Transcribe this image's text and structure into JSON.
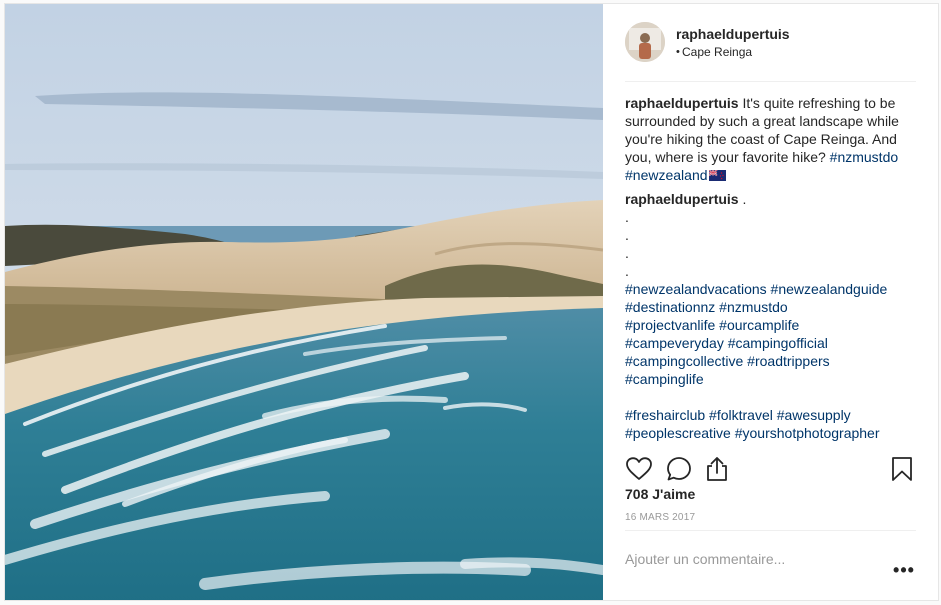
{
  "post": {
    "username": "raphaeldupertuis",
    "location": "Cape Reinga",
    "location_bullet": "•",
    "caption": {
      "user": "raphaeldupertuis",
      "text": " It's quite refreshing to be surrounded by such a great landscape while you're hiking the coast of Cape Reinga. And you, where is your favorite hike? ",
      "tag1": "#nzmustdo",
      "tag2": "#newzealand"
    },
    "comment": {
      "user": "raphaeldupertuis",
      "text": " .",
      "dots": [
        ".",
        ".",
        ".",
        "."
      ],
      "tag_lines_1": [
        "#newzealandvacations #newzealandguide",
        "#destinationnz #nzmustdo",
        "#projectvanlife #ourcamplife",
        "#campeveryday #campingofficial",
        "#campingcollective #roadtrippers",
        "#campinglife"
      ],
      "tag_lines_2": [
        "#freshairclub #folktravel #awesupply",
        "#peoplescreative #yourshotphotographer"
      ]
    },
    "likes": "708 J'aime",
    "date": "16 MARS 2017",
    "comment_placeholder": "Ajouter un commentaire...",
    "more_label": "•••"
  },
  "icons": {
    "like": "heart-icon",
    "comment": "comment-icon",
    "share": "share-icon",
    "save": "bookmark-icon",
    "flag": "new-zealand-flag-icon"
  },
  "colors": {
    "hashtag": "#003569",
    "text": "#262626",
    "muted": "#999999"
  }
}
